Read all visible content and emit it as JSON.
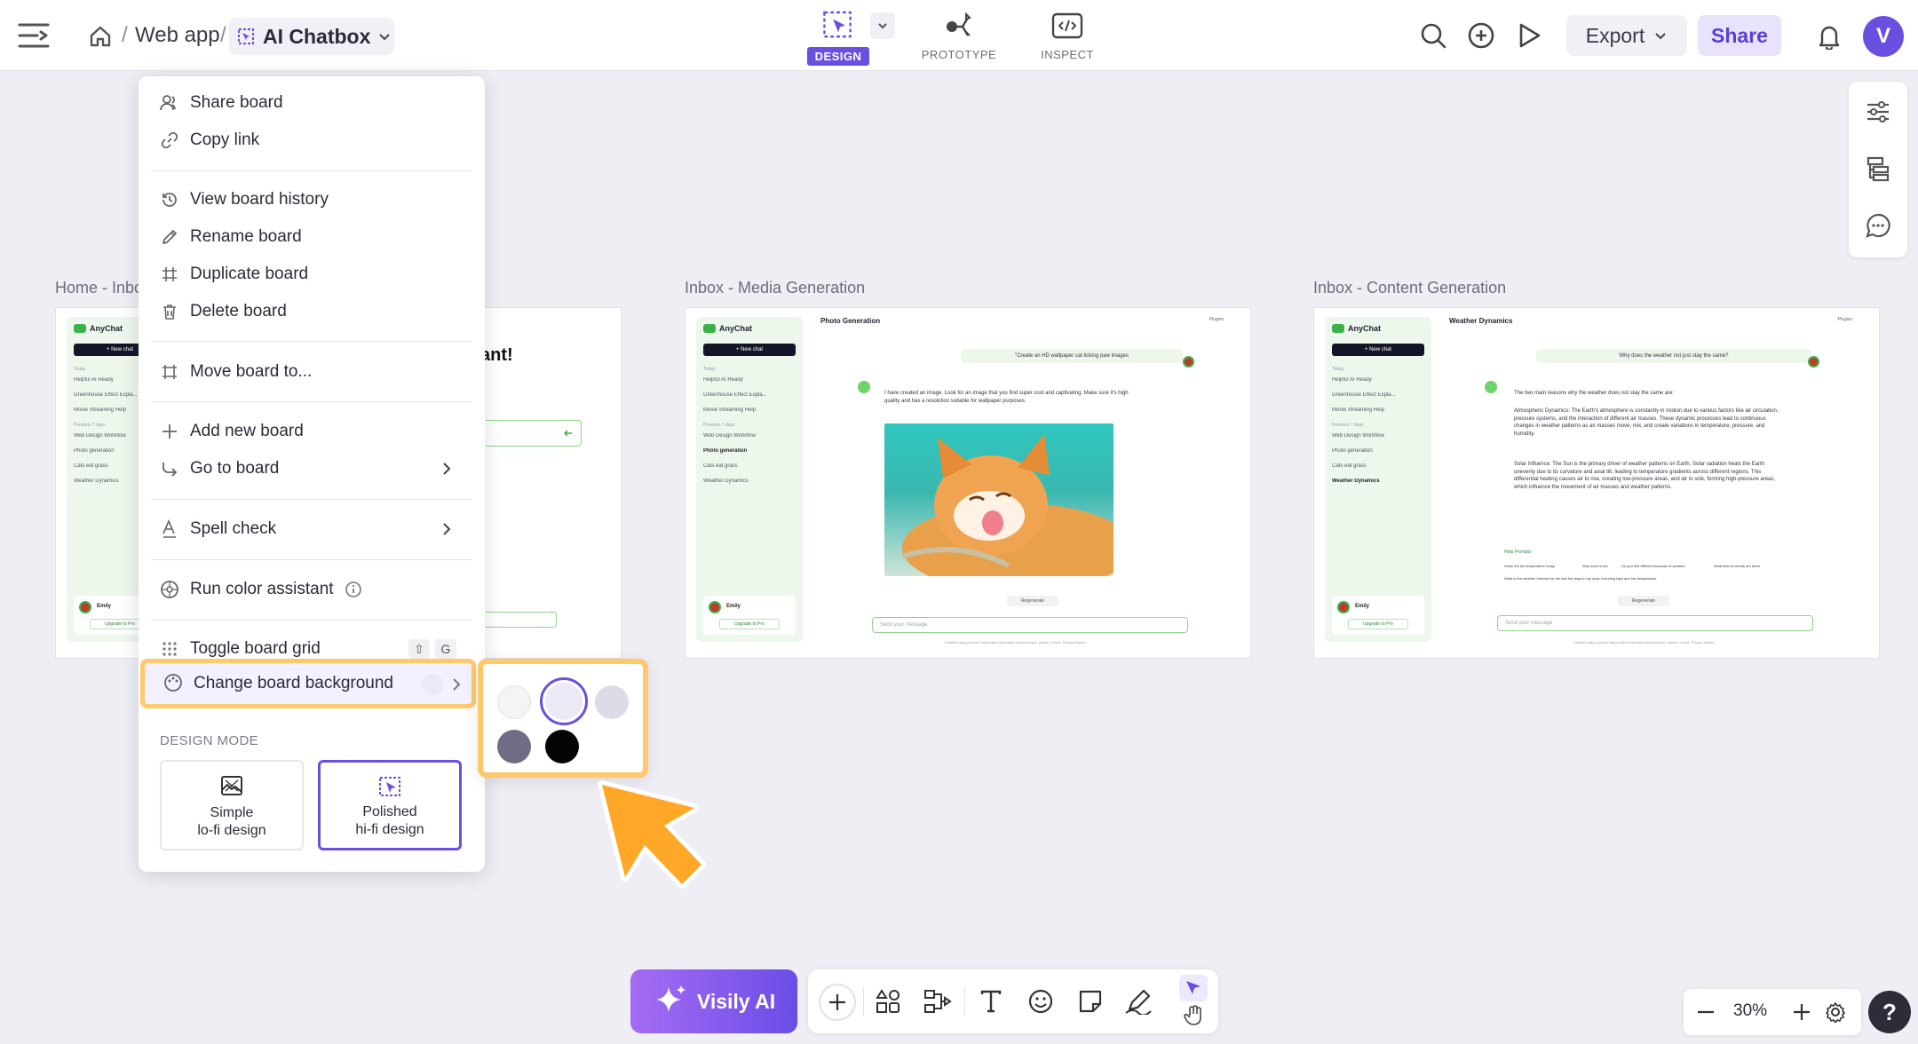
{
  "colors": {
    "accent": "#6b4fe0",
    "highlight": "#ffc86a",
    "canvas": "#eeeef4",
    "pointer": "#ffa726"
  },
  "breadcrumb": {
    "home_icon": "home-icon",
    "sep": "/",
    "project": "Web app",
    "board": "AI Chatbox"
  },
  "modes": {
    "design": "DESIGN",
    "prototype": "PROTOTYPE",
    "inspect": "INSPECT"
  },
  "header": {
    "export_label": "Export",
    "share_label": "Share",
    "avatar_letter": "V"
  },
  "menu": {
    "share_board": "Share board",
    "copy_link": "Copy link",
    "view_history": "View board history",
    "rename": "Rename board",
    "duplicate": "Duplicate board",
    "delete": "Delete board",
    "move_to": "Move board to...",
    "add_new": "Add new board",
    "go_to": "Go to board",
    "spell_check": "Spell check",
    "color_assistant": "Run color assistant",
    "toggle_grid": "Toggle board grid",
    "grid_shortcut": [
      "⇧",
      "G"
    ],
    "change_bg": "Change board background",
    "design_mode_caption": "DESIGN MODE",
    "simple_line1": "Simple",
    "simple_line2": "lo-fi design",
    "polished_line1": "Polished",
    "polished_line2": "hi-fi design"
  },
  "swatches": [
    "#f4f4f7",
    "#ebe9f5",
    "#dcdbe6",
    "#6f6c85",
    "#050505"
  ],
  "frames": {
    "home_title": "Home - Inbox",
    "home_partial_text": "ant!",
    "media_title": "Inbox - Media Generation",
    "content_title": "Inbox - Content Generation",
    "app_name": "AnyChat",
    "new_chat": "+ New chat",
    "today": "Today",
    "prev7": "Previous 7 days",
    "list_today": [
      "Helpful AI Ready",
      "Greenhouse Effect Expla...",
      "Movie Streaming Help"
    ],
    "list_prev": [
      "Web Design Workflow",
      "Photo generation",
      "Cats eat grass",
      "Weather Dynamics"
    ],
    "user_name": "Emily",
    "upgrade": "Upgrade to Pro",
    "plugins": "Plugins",
    "send_placeholder": "Send your message",
    "regenerate": "Regenerate",
    "footnote": "ChatBot may produce inaccurate information about people, places, or fact. Privacy Notice",
    "media": {
      "head": "Photo Generation",
      "question": "\"Create an HD wallpaper cat licking paw images",
      "answer": "I have created an image. Look for an image that you find super cool and captivating. Make sure it's high quality and has a resolution suitable for wallpaper purposes."
    },
    "content": {
      "head": "Weather Dynamics",
      "question": "Why does the weather not just stay the same?",
      "answer_intro": "The two main reasons why the weather does not stay the same are:",
      "answer_p1": "Atmospheric Dynamics: The Earth's atmosphere is constantly in motion due to various factors like air circulation, pressure systems, and the interaction of different air masses. These dynamic processes lead to continuous changes in weather patterns as air masses move, mix, and create variations in temperature, pressure, and humidity.",
      "answer_p2": "Solar Influence: The Sun is the primary driver of weather patterns on Earth. Solar radiation heats the Earth unevenly due to its curvature and axial tilt, leading to temperature gradients across different regions. This differential heating causes air to rise, creating low-pressure areas, and air to sink, forming high-pressure areas, which influence the movement of air masses and weather patterns.",
      "help_prompts": "Help Prompts",
      "prompts": [
        "Show me the temperature today",
        "Why does it rain",
        "Do you feel different because of weather",
        "What kind of clouds are there"
      ],
      "prompt_long": "What is the weather forecast for the last five days in my area, including high and low temperature"
    }
  },
  "bottom": {
    "visily_label": "Visily AI",
    "zoom": "30%",
    "help": "?"
  }
}
